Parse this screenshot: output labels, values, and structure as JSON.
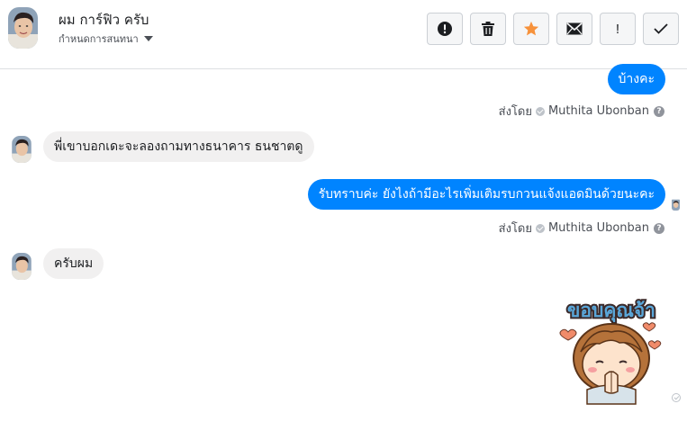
{
  "header": {
    "contact_name": "ผม การ์ฟิว ครับ",
    "subtitle": "กำหนดการสนทนา"
  },
  "toolbar": {
    "buttons": [
      {
        "icon": "exclamation-circle-icon"
      },
      {
        "icon": "trash-icon"
      },
      {
        "icon": "star-icon",
        "color": "#f7923b"
      },
      {
        "icon": "envelope-icon"
      },
      {
        "icon": "exclamation-icon",
        "text": "!"
      },
      {
        "icon": "checkmark-icon"
      }
    ]
  },
  "messages": [
    {
      "direction": "out",
      "text": "บ้างคะ"
    },
    {
      "direction": "in",
      "text": "พี่เขาบอกเดะจะลองถามทางธนาคาร ธนชาตดู"
    },
    {
      "direction": "out",
      "text": "รับทราบค่ะ ยังไงถ้ามีอะไรเพิ่มเติมรบกวนแจ้งแอดมินด้วยนะคะ"
    },
    {
      "direction": "in",
      "text": "ครับผม"
    }
  ],
  "sent_by": {
    "label": "ส่งโดย",
    "name": "Muthita Ubonban",
    "help": "?"
  },
  "sticker": {
    "text": "ขอบคุณจ้า"
  },
  "colors": {
    "accent_blue": "#0084ff",
    "incoming_bubble": "#f1f0f0",
    "star_orange": "#f7923b"
  }
}
